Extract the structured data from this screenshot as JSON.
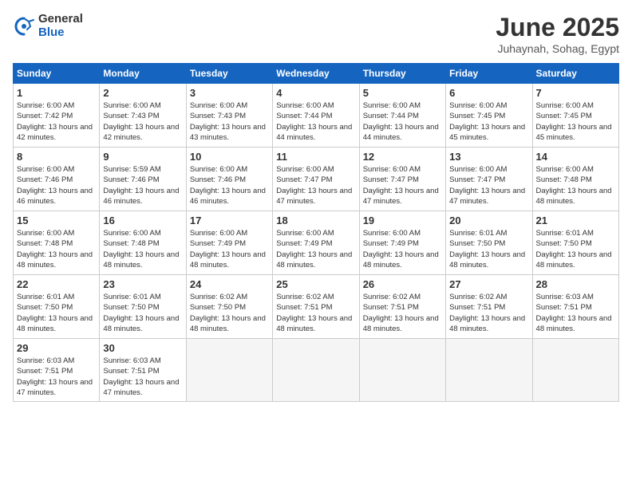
{
  "logo": {
    "general": "General",
    "blue": "Blue"
  },
  "title": "June 2025",
  "location": "Juhaynah, Sohag, Egypt",
  "weekdays": [
    "Sunday",
    "Monday",
    "Tuesday",
    "Wednesday",
    "Thursday",
    "Friday",
    "Saturday"
  ],
  "weeks": [
    [
      {
        "day": 1,
        "sunrise": "6:00 AM",
        "sunset": "7:42 PM",
        "daylight": "13 hours and 42 minutes."
      },
      {
        "day": 2,
        "sunrise": "6:00 AM",
        "sunset": "7:43 PM",
        "daylight": "13 hours and 42 minutes."
      },
      {
        "day": 3,
        "sunrise": "6:00 AM",
        "sunset": "7:43 PM",
        "daylight": "13 hours and 43 minutes."
      },
      {
        "day": 4,
        "sunrise": "6:00 AM",
        "sunset": "7:44 PM",
        "daylight": "13 hours and 44 minutes."
      },
      {
        "day": 5,
        "sunrise": "6:00 AM",
        "sunset": "7:44 PM",
        "daylight": "13 hours and 44 minutes."
      },
      {
        "day": 6,
        "sunrise": "6:00 AM",
        "sunset": "7:45 PM",
        "daylight": "13 hours and 45 minutes."
      },
      {
        "day": 7,
        "sunrise": "6:00 AM",
        "sunset": "7:45 PM",
        "daylight": "13 hours and 45 minutes."
      }
    ],
    [
      {
        "day": 8,
        "sunrise": "6:00 AM",
        "sunset": "7:46 PM",
        "daylight": "13 hours and 46 minutes."
      },
      {
        "day": 9,
        "sunrise": "5:59 AM",
        "sunset": "7:46 PM",
        "daylight": "13 hours and 46 minutes."
      },
      {
        "day": 10,
        "sunrise": "6:00 AM",
        "sunset": "7:46 PM",
        "daylight": "13 hours and 46 minutes."
      },
      {
        "day": 11,
        "sunrise": "6:00 AM",
        "sunset": "7:47 PM",
        "daylight": "13 hours and 47 minutes."
      },
      {
        "day": 12,
        "sunrise": "6:00 AM",
        "sunset": "7:47 PM",
        "daylight": "13 hours and 47 minutes."
      },
      {
        "day": 13,
        "sunrise": "6:00 AM",
        "sunset": "7:47 PM",
        "daylight": "13 hours and 47 minutes."
      },
      {
        "day": 14,
        "sunrise": "6:00 AM",
        "sunset": "7:48 PM",
        "daylight": "13 hours and 48 minutes."
      }
    ],
    [
      {
        "day": 15,
        "sunrise": "6:00 AM",
        "sunset": "7:48 PM",
        "daylight": "13 hours and 48 minutes."
      },
      {
        "day": 16,
        "sunrise": "6:00 AM",
        "sunset": "7:48 PM",
        "daylight": "13 hours and 48 minutes."
      },
      {
        "day": 17,
        "sunrise": "6:00 AM",
        "sunset": "7:49 PM",
        "daylight": "13 hours and 48 minutes."
      },
      {
        "day": 18,
        "sunrise": "6:00 AM",
        "sunset": "7:49 PM",
        "daylight": "13 hours and 48 minutes."
      },
      {
        "day": 19,
        "sunrise": "6:00 AM",
        "sunset": "7:49 PM",
        "daylight": "13 hours and 48 minutes."
      },
      {
        "day": 20,
        "sunrise": "6:01 AM",
        "sunset": "7:50 PM",
        "daylight": "13 hours and 48 minutes."
      },
      {
        "day": 21,
        "sunrise": "6:01 AM",
        "sunset": "7:50 PM",
        "daylight": "13 hours and 48 minutes."
      }
    ],
    [
      {
        "day": 22,
        "sunrise": "6:01 AM",
        "sunset": "7:50 PM",
        "daylight": "13 hours and 48 minutes."
      },
      {
        "day": 23,
        "sunrise": "6:01 AM",
        "sunset": "7:50 PM",
        "daylight": "13 hours and 48 minutes."
      },
      {
        "day": 24,
        "sunrise": "6:02 AM",
        "sunset": "7:50 PM",
        "daylight": "13 hours and 48 minutes."
      },
      {
        "day": 25,
        "sunrise": "6:02 AM",
        "sunset": "7:51 PM",
        "daylight": "13 hours and 48 minutes."
      },
      {
        "day": 26,
        "sunrise": "6:02 AM",
        "sunset": "7:51 PM",
        "daylight": "13 hours and 48 minutes."
      },
      {
        "day": 27,
        "sunrise": "6:02 AM",
        "sunset": "7:51 PM",
        "daylight": "13 hours and 48 minutes."
      },
      {
        "day": 28,
        "sunrise": "6:03 AM",
        "sunset": "7:51 PM",
        "daylight": "13 hours and 48 minutes."
      }
    ],
    [
      {
        "day": 29,
        "sunrise": "6:03 AM",
        "sunset": "7:51 PM",
        "daylight": "13 hours and 47 minutes."
      },
      {
        "day": 30,
        "sunrise": "6:03 AM",
        "sunset": "7:51 PM",
        "daylight": "13 hours and 47 minutes."
      },
      null,
      null,
      null,
      null,
      null
    ]
  ]
}
